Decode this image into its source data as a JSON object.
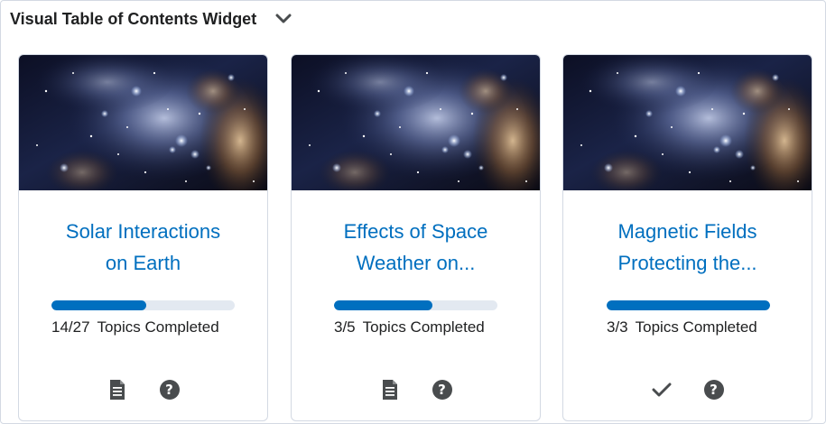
{
  "widget": {
    "title": "Visual Table of Contents Widget",
    "collapse_icon": "chevron-down-icon"
  },
  "colors": {
    "link": "#006fbf",
    "progress_fill": "#006fbf",
    "progress_track": "#e3e9f1",
    "icon": "#494c4e"
  },
  "cards": [
    {
      "title_line1": "Solar Interactions",
      "title_line2": "on Earth",
      "progress_fraction": 0.5185,
      "completed": "14/27",
      "completed_label": "Topics Completed",
      "icons": [
        "document-icon",
        "help-icon"
      ]
    },
    {
      "title_line1": "Effects of Space",
      "title_line2": "Weather on...",
      "progress_fraction": 0.6,
      "completed": "3/5",
      "completed_label": "Topics Completed",
      "icons": [
        "document-icon",
        "help-icon"
      ]
    },
    {
      "title_line1": "Magnetic Fields",
      "title_line2": "Protecting the...",
      "progress_fraction": 1.0,
      "completed": "3/3",
      "completed_label": "Topics Completed",
      "icons": [
        "checkmark-icon",
        "help-icon"
      ]
    }
  ],
  "help_glyph": "?"
}
